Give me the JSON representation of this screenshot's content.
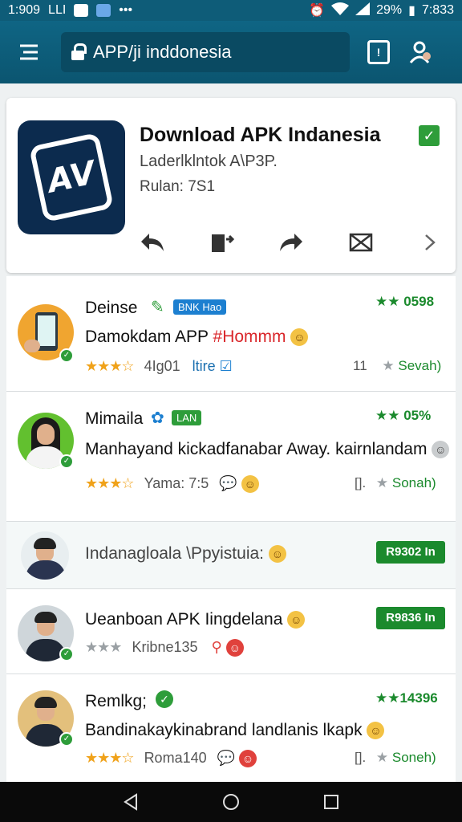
{
  "status_bar": {
    "time_left": "1:909",
    "carrier": "LLI",
    "battery": "29%",
    "time_right": "7:833"
  },
  "toolbar": {
    "url": "APP/ji inddonesia",
    "tab_count": "!"
  },
  "app": {
    "title": "Download APK Indanesia",
    "subtitle": "Laderlklntok A\\P3P.",
    "meta": "Rulan: 7S1",
    "logo_text": "AV",
    "verified_icon": "check-icon"
  },
  "items": [
    {
      "name": "Deinse",
      "badge": "BNK Hao",
      "rating": "★★ 0598",
      "title_black": "Damokdam APP ",
      "title_red": "#Hommm",
      "meta_rating": "4Ig01",
      "meta_tag": "ltire",
      "right_num": "11",
      "right_time": "Sevah)"
    },
    {
      "name": "Mimaila",
      "badge": "LAN",
      "rating": "★★ 05%",
      "title_black": "Manhayand kickadfanabar Away. kairnlandam",
      "title_red": "",
      "meta_rating": "Yama: 7:5",
      "meta_tag": "",
      "right_num": "[].",
      "right_time": "Sonah)"
    },
    {
      "name": "",
      "badge": "",
      "rating": "",
      "title_black": "Indanagloala \\Ppyistuia:",
      "title_red": "",
      "meta_rating": "",
      "meta_tag": "",
      "right_num": "",
      "right_time": "",
      "pill": "R9302 In"
    },
    {
      "name": "",
      "badge": "",
      "rating": "",
      "title_black": "Ueanboan APK Iingdelana",
      "title_red": "",
      "meta_rating": "Kribne13",
      "meta_tag": "5",
      "right_num": "",
      "right_time": "",
      "pill": "R9836 In"
    },
    {
      "name": "Remlkg;",
      "badge": "",
      "rating": "★★14396",
      "title_black": "Bandinakaykinabrand landlanis lkapk",
      "title_red": "",
      "meta_rating": "Roma140",
      "meta_tag": "",
      "right_num": "[].",
      "right_time": "Soneh)"
    }
  ]
}
